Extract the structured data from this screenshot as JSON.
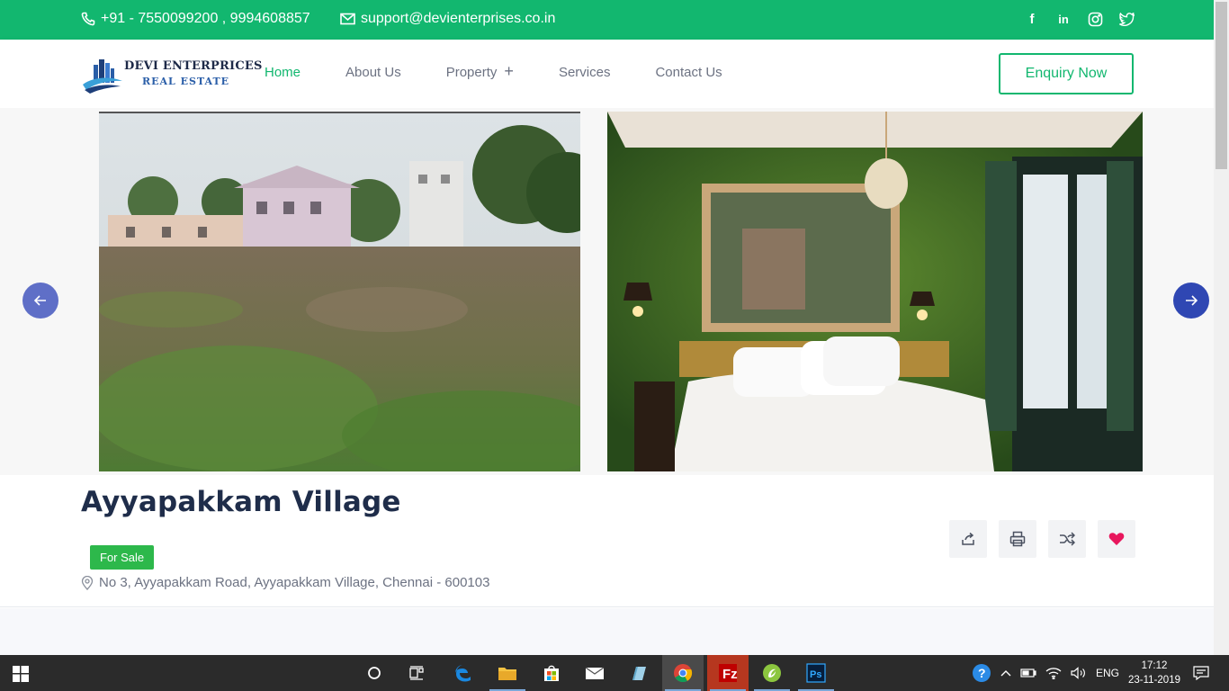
{
  "topbar": {
    "phone": "+91 - 7550099200 , 9994608857",
    "email": "support@devienterprises.co.in",
    "social_icons": [
      "facebook-icon",
      "linkedin-icon",
      "instagram-icon",
      "twitter-icon"
    ]
  },
  "header": {
    "logo_line1": "DEVI ENTERPRICES",
    "logo_line2": "REAL ESTATE",
    "nav": {
      "home": "Home",
      "about": "About Us",
      "property": "Property",
      "property_plus": "+",
      "services": "Services",
      "contact": "Contact Us"
    },
    "enquiry_label": "Enquiry Now"
  },
  "gallery": {
    "images": [
      "open-plot-land-photo",
      "green-hotel-bedroom-photo"
    ],
    "prev_icon": "arrow-left-icon",
    "next_icon": "arrow-right-icon"
  },
  "property": {
    "title": "Ayyapakkam Village",
    "status_badge": "For Sale",
    "address": "No 3, Ayyapakkam Road, Ayyapakkam Village, Chennai - 600103",
    "actions": [
      "share-icon",
      "print-icon",
      "compare-icon",
      "favorite-icon"
    ]
  },
  "colors": {
    "brand_green": "#12b76f",
    "badge_green": "#2db84b",
    "title_navy": "#1f2d4a",
    "arrow_blue": "#2f47b3",
    "favorite_pink": "#e8175d"
  },
  "taskbar": {
    "apps": [
      "start-icon",
      "cortana-icon",
      "task-view-icon",
      "edge-icon",
      "file-explorer-icon",
      "store-icon",
      "mail-icon",
      "notepad-icon",
      "chrome-icon",
      "filezilla-icon",
      "dreamweaver-icon",
      "photoshop-icon"
    ],
    "language": "ENG",
    "time": "17:12",
    "date": "23-11-2019"
  }
}
